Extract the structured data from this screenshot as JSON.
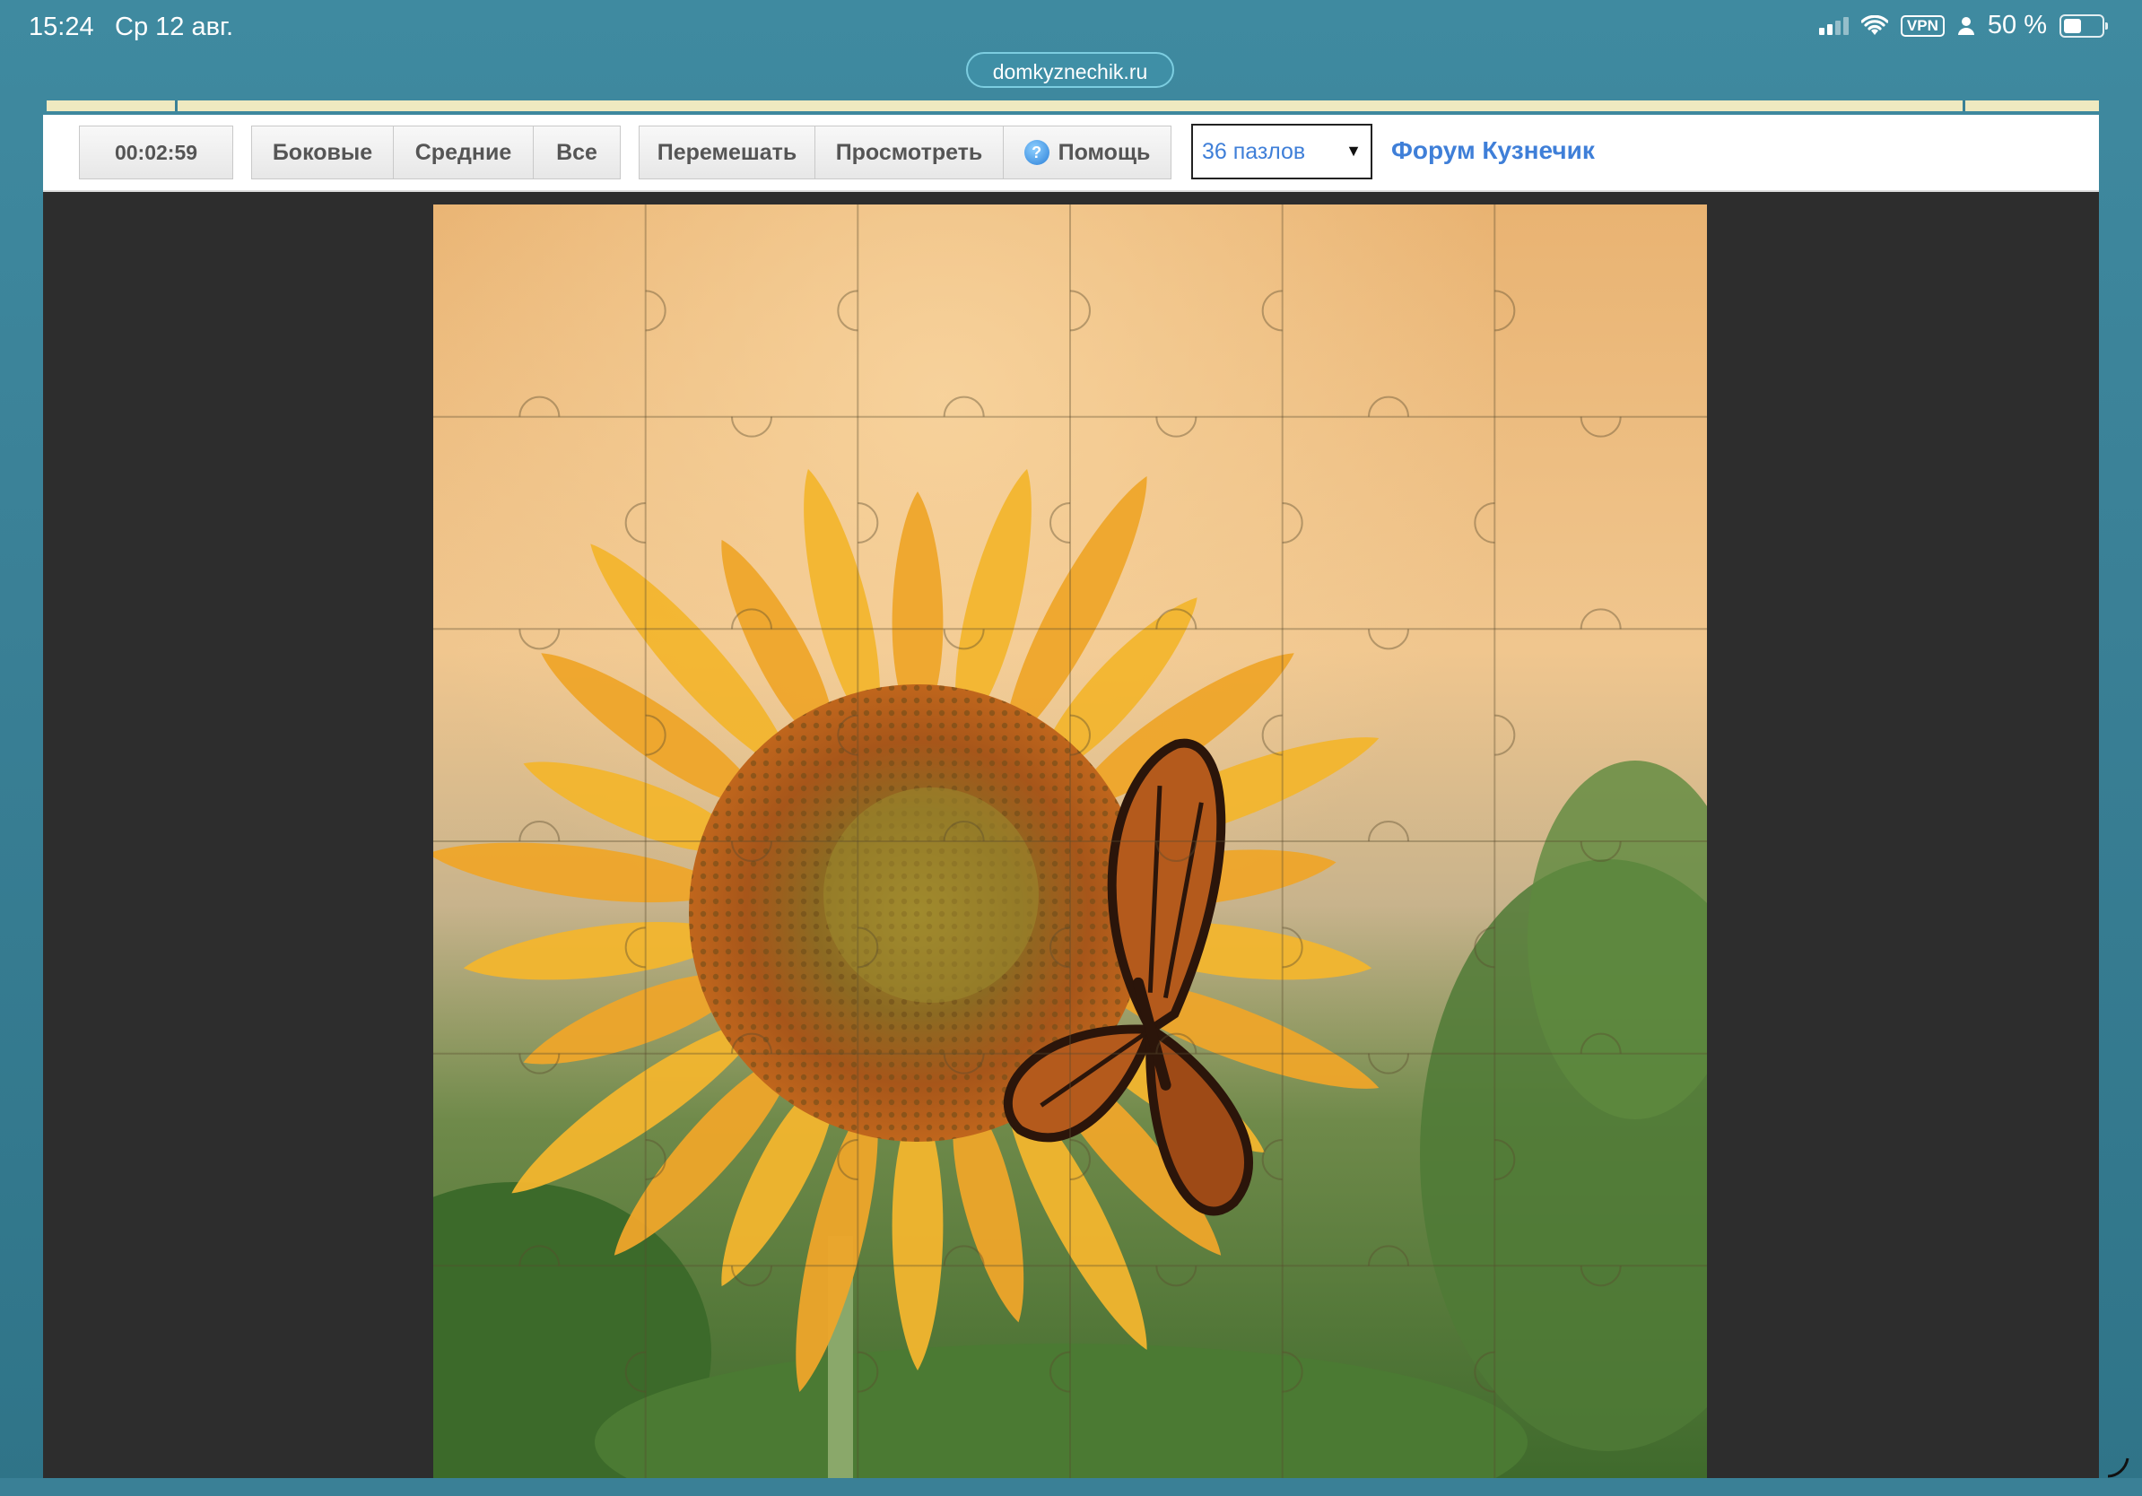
{
  "status_bar": {
    "time": "15:24",
    "date": "Ср 12 авг.",
    "vpn": "VPN",
    "battery": "50 %"
  },
  "browser": {
    "url": "domkyznechik.ru"
  },
  "toolbar": {
    "timer": "00:02:59",
    "filters": [
      "Боковые",
      "Средние",
      "Все"
    ],
    "actions": [
      "Перемешать",
      "Просмотреть",
      "Помощь"
    ],
    "pieces_select": {
      "selected": "36 пазлов"
    },
    "forum_link": "Форум Кузнечик"
  },
  "puzzle": {
    "rows": 6,
    "cols": 6,
    "image": "sunflower with monarch butterfly"
  },
  "colors": {
    "page_bg": "#3a8096",
    "accent_link": "#3f7fd8",
    "canvas_bg": "#2d2d2d"
  }
}
